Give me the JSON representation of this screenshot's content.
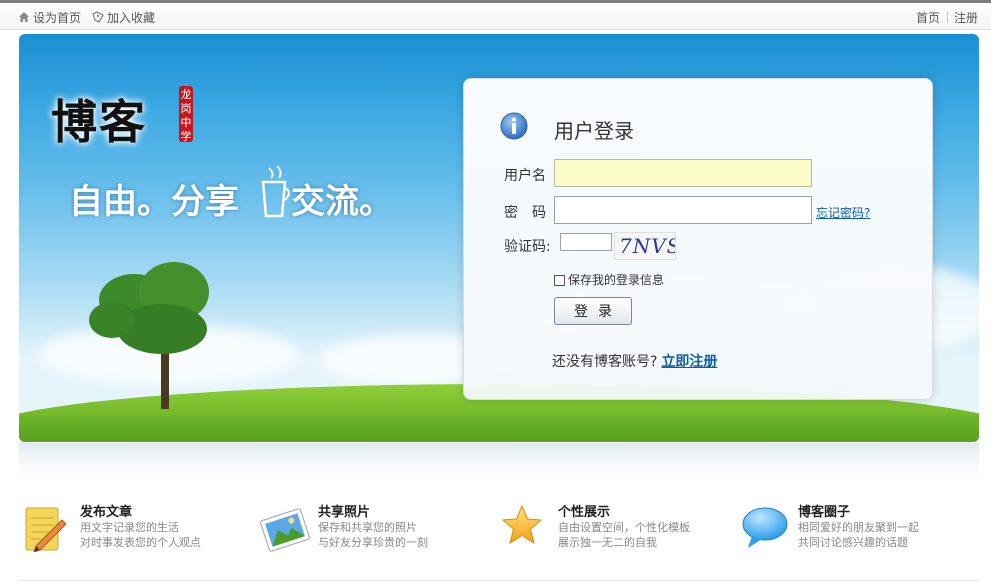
{
  "topbar": {
    "set_home": "设为首页",
    "add_favorite": "加入收藏",
    "home": "首页",
    "register": "注册"
  },
  "banner": {
    "logo": "博客",
    "seal": "龙岗中学",
    "slogan": "自由。分享",
    "slogan2": "交流。"
  },
  "login": {
    "title": "用户登录",
    "username_label": "用户名",
    "username_value": "",
    "password_label": "密　码",
    "password_value": "",
    "forgot": "忘记密码?",
    "captcha_label": "验证码:",
    "captcha_value": "",
    "captcha_image": "7NVS",
    "remember": "保存我的登录信息",
    "submit": "登录",
    "no_account": "还没有博客账号?",
    "register_now": "立即注册"
  },
  "features": [
    {
      "title": "发布文章",
      "line1": "用文字记录您的生活",
      "line2": "对时事发表您的个人观点",
      "icon": "notepad-pencil-icon"
    },
    {
      "title": "共享照片",
      "line1": "保存和共享您的照片",
      "line2": "与好友分享珍贵的一刻",
      "icon": "photo-icon"
    },
    {
      "title": "个性展示",
      "line1": "自由设置空间，个性化模板",
      "line2": "展示独一无二的自我",
      "icon": "star-icon"
    },
    {
      "title": "博客圈子",
      "line1": "相同爱好的朋友聚到一起",
      "line2": "共同讨论感兴趣的话题",
      "icon": "speech-bubble-icon"
    }
  ],
  "colors": {
    "link": "#0b5fa8",
    "field_active": "#fcfcc8",
    "sky": "#3aa7e2",
    "grass": "#5fa81d"
  }
}
